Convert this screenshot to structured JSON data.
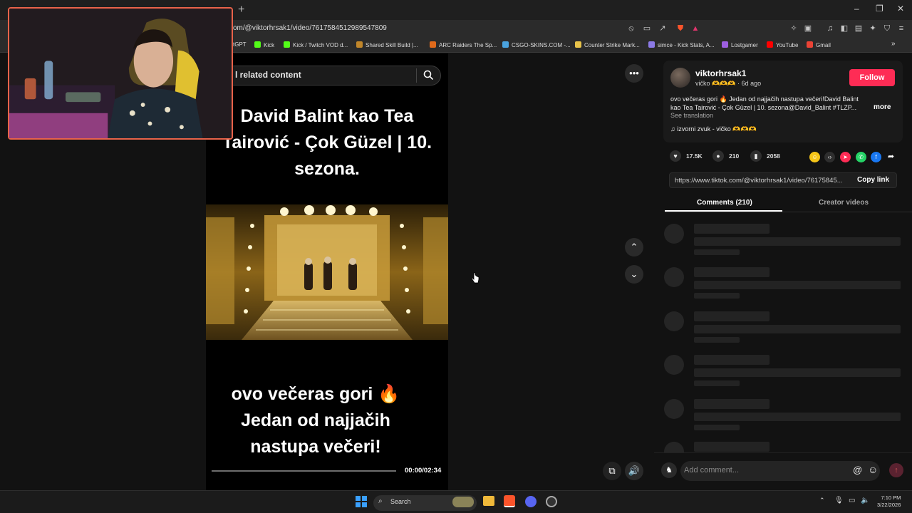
{
  "browser": {
    "new_tab_glyph": "+",
    "url": "om/@viktorhrsak1/video/7617584512989547809",
    "window_controls": [
      "–",
      "❐",
      "✕"
    ],
    "bookmarks": [
      {
        "label": "tGPT",
        "color": "#777777"
      },
      {
        "label": "Kick",
        "color": "#53fc18"
      },
      {
        "label": "Kick / Twitch VOD d...",
        "color": "#53fc18"
      },
      {
        "label": "Shared Skill Build |...",
        "color": "#c0862a"
      },
      {
        "label": "ARC Raiders The Sp...",
        "color": "#e06a1b"
      },
      {
        "label": "CSGO-SKINS.COM -...",
        "color": "#4aa3df"
      },
      {
        "label": "Counter Strike Mark...",
        "color": "#e8c34a"
      },
      {
        "label": "simce - Kick Stats, A...",
        "color": "#8c7ae6"
      },
      {
        "label": "Lostgamer",
        "color": "#9d5fe0"
      },
      {
        "label": "YouTube",
        "color": "#ff0000"
      },
      {
        "label": "Gmail",
        "color": "#ea4335"
      }
    ]
  },
  "video": {
    "search_text": "l related content",
    "title": "David Balint kao Tea Tairović - Çok Güzel | 10. sezona.",
    "caption": "ovo večeras gori 🔥 Jedan od najjačih nastupa večeri!",
    "time": "00:00/02:34",
    "progress": 0
  },
  "post": {
    "username": "viktorhrsak1",
    "subline": "vičko 🫶🫶🫶 · 6d ago",
    "follow_label": "Follow",
    "description": "ovo večeras gori 🔥 Jedan od najjačih nastupa večeri!David Balint kao Tea Tairović - Çok Güzel | 10. sezona@David_Balint #TLZP...",
    "more_label": "more",
    "see_translation": "See translation",
    "music": "♫  izvorni zvuk - vičko 🫶🫶🫶",
    "likes": "17.5K",
    "comments": "210",
    "saves": "2058",
    "link": "https://www.tiktok.com/@viktorhrsak1/video/76175845...",
    "copy_link_label": "Copy link",
    "tab_comments": "Comments (210)",
    "tab_creator": "Creator videos",
    "comment_placeholder": "Add comment..."
  },
  "taskbar": {
    "search_label": "Search",
    "time": "7:10 PM",
    "date": "3/22/2026"
  }
}
